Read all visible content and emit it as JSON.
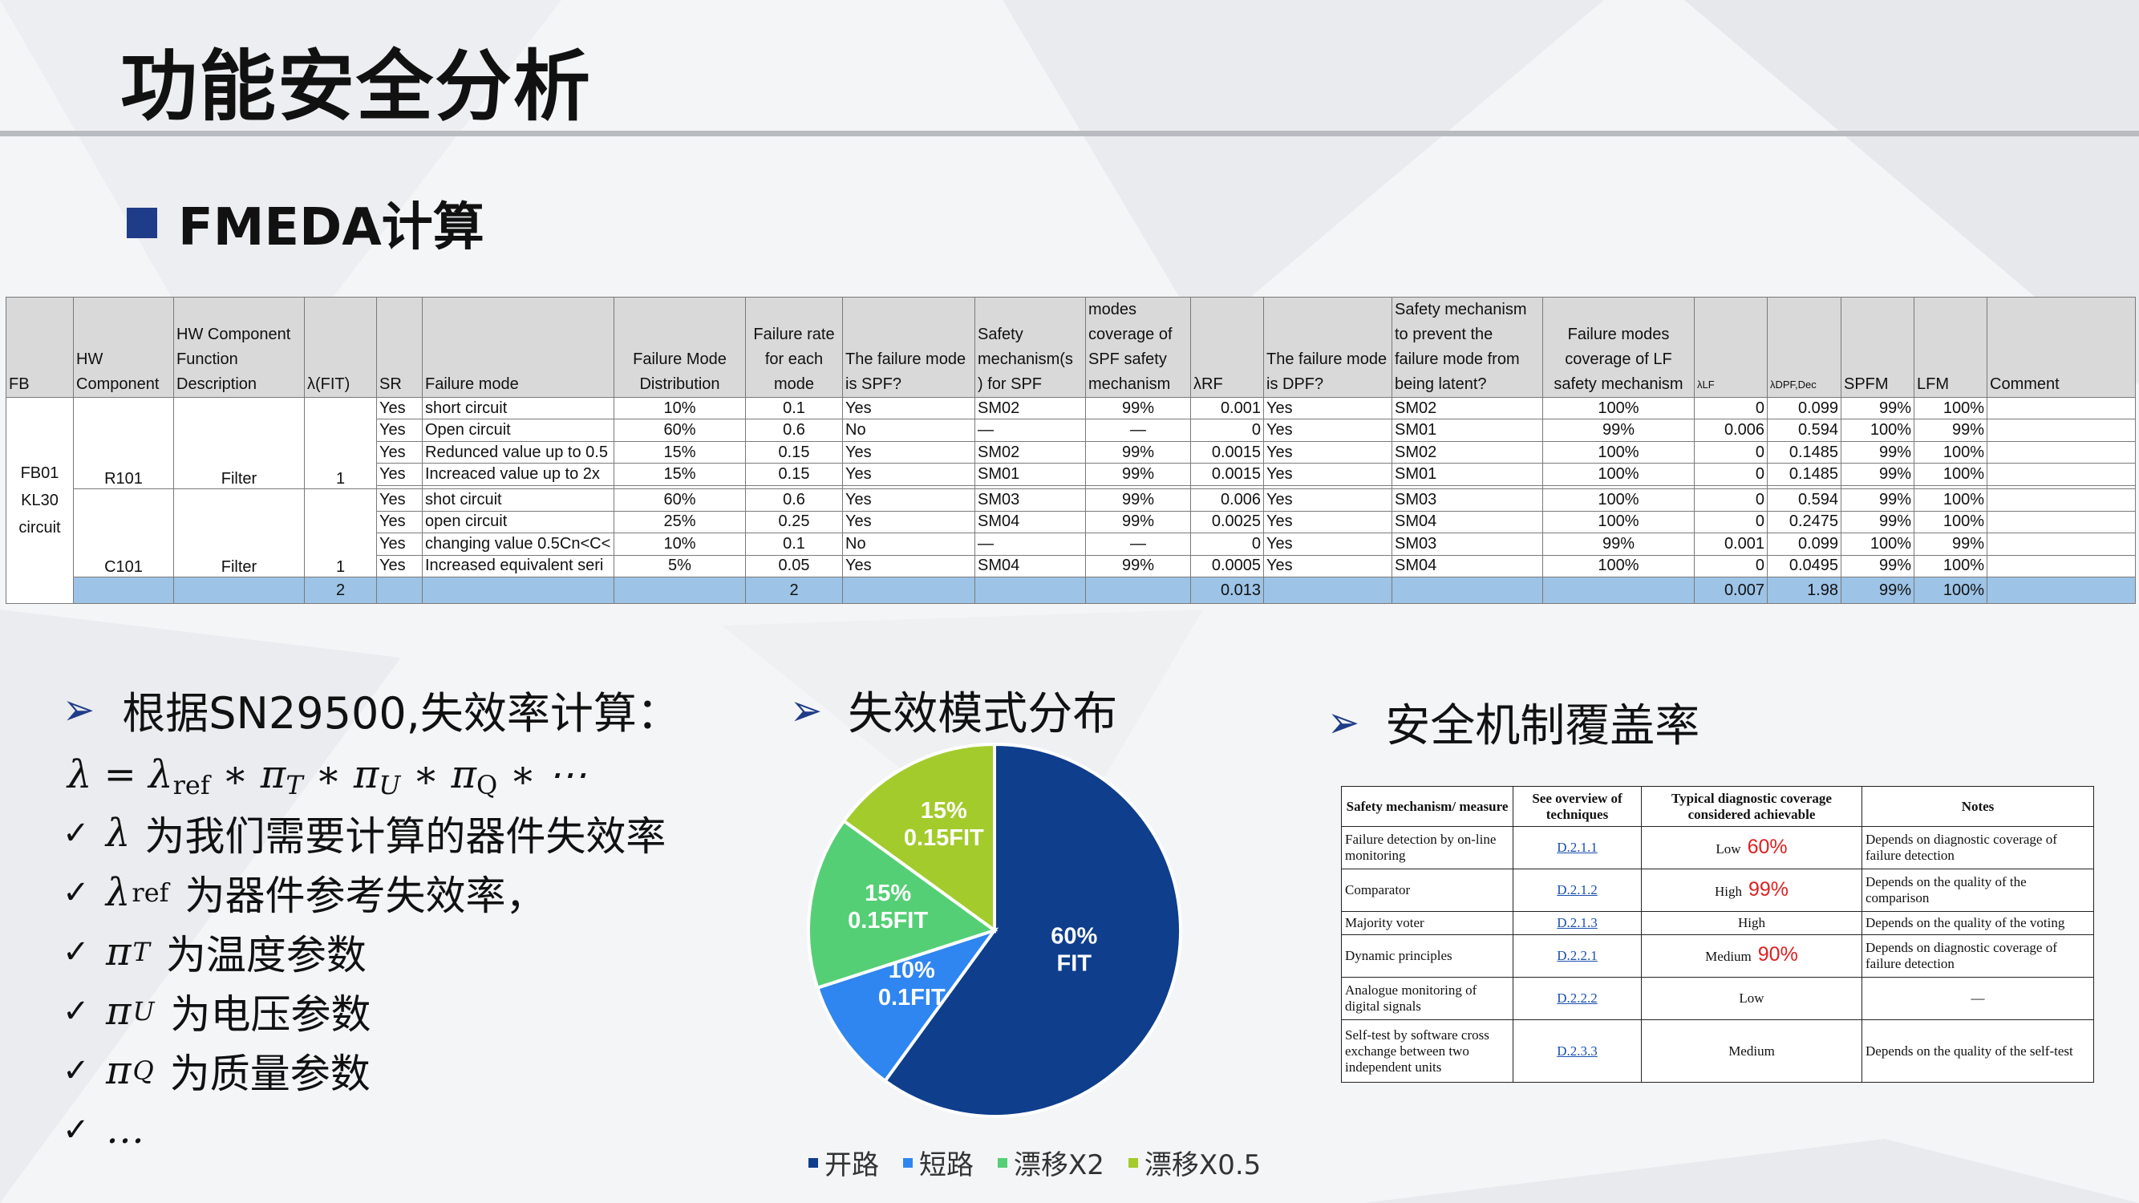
{
  "title": "功能安全分析",
  "subtitle": "FMEDA计算",
  "fmeda": {
    "headers": [
      "FB",
      "HW Component",
      "HW Component Function Description",
      "λ(FIT)",
      "SR",
      "Failure mode",
      "Failure Mode Distribution",
      "Failure rate for each mode",
      "The failure mode is SPF?",
      "Safety mechanism(s ) for SPF",
      "modes coverage of SPF safety mechanism",
      "λRF",
      "The failure mode is DPF?",
      "Safety mechanism to prevent the failure mode from being latent?",
      "Failure modes coverage of LF safety mechanism",
      "λLF",
      "λDPF,Dec",
      "SPFM",
      "LFM",
      "Comment"
    ],
    "fb": "FB01 KL30 circuit",
    "groups": [
      {
        "component": "R101",
        "function": "Filter",
        "lambda": "1"
      },
      {
        "component": "C101",
        "function": "Filter",
        "lambda": "1"
      }
    ],
    "rows": [
      [
        "Yes",
        "short circuit",
        "10%",
        "0.1",
        "Yes",
        "SM02",
        "99%",
        "0.001",
        "Yes",
        "SM02",
        "100%",
        "0",
        "0.099",
        "99%",
        "100%"
      ],
      [
        "Yes",
        "Open circuit",
        "60%",
        "0.6",
        "No",
        "—",
        "—",
        "0",
        "Yes",
        "SM01",
        "99%",
        "0.006",
        "0.594",
        "100%",
        "99%"
      ],
      [
        "Yes",
        "Redunced value up to 0.5",
        "15%",
        "0.15",
        "Yes",
        "SM02",
        "99%",
        "0.0015",
        "Yes",
        "SM02",
        "100%",
        "0",
        "0.1485",
        "99%",
        "100%"
      ],
      [
        "Yes",
        "Increaced value up to 2x",
        "15%",
        "0.15",
        "Yes",
        "SM01",
        "99%",
        "0.0015",
        "Yes",
        "SM01",
        "100%",
        "0",
        "0.1485",
        "99%",
        "100%"
      ],
      [
        "Yes",
        "shot circuit",
        "60%",
        "0.6",
        "Yes",
        "SM03",
        "99%",
        "0.006",
        "Yes",
        "SM03",
        "100%",
        "0",
        "0.594",
        "99%",
        "100%"
      ],
      [
        "Yes",
        "open circuit",
        "25%",
        "0.25",
        "Yes",
        "SM04",
        "99%",
        "0.0025",
        "Yes",
        "SM04",
        "100%",
        "0",
        "0.2475",
        "99%",
        "100%"
      ],
      [
        "Yes",
        "changing value 0.5Cn<C<",
        "10%",
        "0.1",
        "No",
        "—",
        "—",
        "0",
        "Yes",
        "SM03",
        "99%",
        "0.001",
        "0.099",
        "100%",
        "99%"
      ],
      [
        "Yes",
        "Increased equivalent seri",
        "5%",
        "0.05",
        "Yes",
        "SM04",
        "99%",
        "0.0005",
        "Yes",
        "SM04",
        "100%",
        "0",
        "0.0495",
        "99%",
        "100%"
      ]
    ],
    "total": {
      "lambda": "2",
      "rate": "2",
      "rf": "0.013",
      "lf": "0.007",
      "dpf": "1.98",
      "spfm": "99%",
      "lfm": "100%"
    }
  },
  "left": {
    "heading": "根据SN29500,失效率计算：",
    "items": [
      {
        "sym": "λ",
        "sub": "",
        "text": "为我们需要计算的器件失效率"
      },
      {
        "sym": "λ",
        "sub": "ref",
        "text": "为器件参考失效率，"
      },
      {
        "sym": "π",
        "sub": "T",
        "text": "为温度参数"
      },
      {
        "sym": "π",
        "sub": "U",
        "text": "为电压参数"
      },
      {
        "sym": "π",
        "sub": "Q",
        "text": "为质量参数"
      },
      {
        "sym": "…",
        "sub": "",
        "text": ""
      }
    ]
  },
  "pie_heading": "失效模式分布",
  "chart_data": {
    "type": "pie",
    "labels": [
      "开路",
      "短路",
      "漂移X2",
      "漂移X0.5"
    ],
    "values": [
      60,
      10,
      15,
      15
    ],
    "slice_labels": [
      "60%\nFIT",
      "10%\n0.1FIT",
      "15%\n0.15FIT",
      "15%\n0.15FIT"
    ],
    "colors": [
      "#0e3e8c",
      "#2f86f0",
      "#55cf75",
      "#a3cb2c"
    ],
    "legend_position": "bottom"
  },
  "coverage": {
    "heading": "安全机制覆盖率",
    "headers": [
      "Safety mechanism/ measure",
      "See overview of techniques",
      "Typical diagnostic coverage considered achievable",
      "Notes"
    ],
    "rows": [
      {
        "measure": "Failure detection by on-line monitoring",
        "ref": "D.2.1.1",
        "level": "Low",
        "pct": "60%",
        "notes": "Depends on diagnostic coverage of failure detection"
      },
      {
        "measure": "Comparator",
        "ref": "D.2.1.2",
        "level": "High",
        "pct": "99%",
        "notes": "Depends on the quality of the comparison"
      },
      {
        "measure": "Majority voter",
        "ref": "D.2.1.3",
        "level": "High",
        "pct": "",
        "notes": "Depends on the quality of the voting"
      },
      {
        "measure": "Dynamic principles",
        "ref": "D.2.2.1",
        "level": "Medium",
        "pct": "90%",
        "notes": "Depends on diagnostic coverage of failure detection"
      },
      {
        "measure": "Analogue monitoring of digital signals",
        "ref": "D.2.2.2",
        "level": "Low",
        "pct": "",
        "notes": "—"
      },
      {
        "measure": "Self-test by software cross exchange between two independent units",
        "ref": "D.2.3.3",
        "level": "Medium",
        "pct": "",
        "notes": "Depends on the quality of the self-test"
      }
    ]
  }
}
